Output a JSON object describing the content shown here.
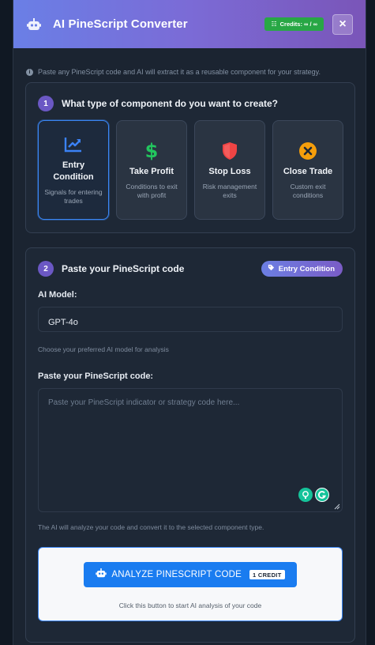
{
  "header": {
    "title": "AI PineScript Converter",
    "credits_label": "Credits: ∞ / ∞",
    "close_label": "×"
  },
  "info_text": "Paste any PineScript code and AI will extract it as a reusable component for your strategy.",
  "step1": {
    "number": "1",
    "title": "What type of component do you want to create?",
    "cards": [
      {
        "title_line1": "Entry",
        "title_line2": "Condition",
        "desc": "Signals for entering trades",
        "icon": "chart-line-icon",
        "color": "#3b82f6",
        "selected": true
      },
      {
        "title_line1": "Take Profit",
        "title_line2": "",
        "desc": "Conditions to exit with profit",
        "icon": "dollar-icon",
        "color": "#22c55e",
        "selected": false
      },
      {
        "title_line1": "Stop Loss",
        "title_line2": "",
        "desc": "Risk management exits",
        "icon": "shield-icon",
        "color": "#ef4444",
        "selected": false
      },
      {
        "title_line1": "Close Trade",
        "title_line2": "",
        "desc": "Custom exit conditions",
        "icon": "times-circle-icon",
        "color": "#f59e0b",
        "selected": false
      }
    ]
  },
  "step2": {
    "number": "2",
    "title": "Paste your PineScript code",
    "badge": "Entry Condition",
    "model_label": "AI Model:",
    "model_value": "GPT-4o",
    "model_hint": "Choose your preferred AI model for analysis",
    "code_label": "Paste your PineScript code:",
    "code_placeholder": "Paste your PineScript indicator or strategy code here...",
    "code_hint": "The AI will analyze your code and convert it to the selected component type.",
    "analyze_label": "ANALYZE PINESCRIPT CODE",
    "analyze_credit": "1 CREDIT",
    "analyze_hint": "Click this button to start AI analysis of your code"
  },
  "colors": {
    "accent": "#1a7cf0",
    "header_gradient_start": "#6a7fe6",
    "header_gradient_end": "#7a55b8",
    "credits_badge": "#28a745"
  }
}
